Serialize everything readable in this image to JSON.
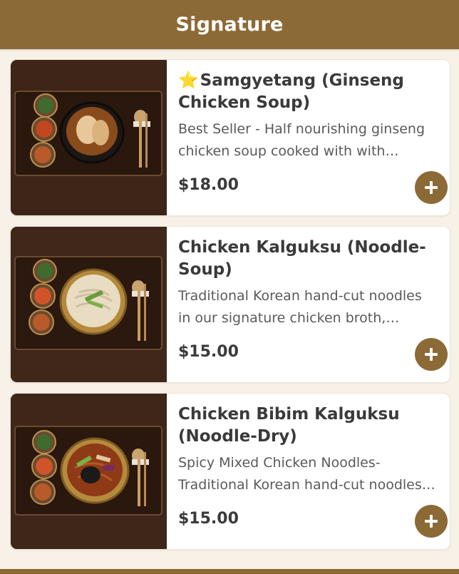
{
  "header": {
    "title": "Signature"
  },
  "colors": {
    "accent": "#8c6a36",
    "star": "#f5b800"
  },
  "items": [
    {
      "title": "Samgyetang (Ginseng Chicken Soup)",
      "star": "⭐",
      "desc_line1": "Best Seller - Half nourishing ginseng",
      "desc_line2": "chicken soup cooked with with…",
      "price": "$18.00",
      "image_icon": "soup-bowl-icon"
    },
    {
      "title": "Chicken Kalguksu (Noodle-Soup)",
      "desc_line1": "Traditional Korean hand-cut noodles",
      "desc_line2": "in our signature chicken broth,…",
      "price": "$15.00",
      "image_icon": "noodle-bowl-icon"
    },
    {
      "title": "Chicken Bibim Kalguksu (Noodle-Dry)",
      "desc_line1": "Spicy Mixed Chicken Noodles-",
      "desc_line2": "Traditional Korean hand-cut noodles…",
      "price": "$15.00",
      "image_icon": "noodle-bowl-icon"
    }
  ],
  "add_icon": "plus-icon"
}
